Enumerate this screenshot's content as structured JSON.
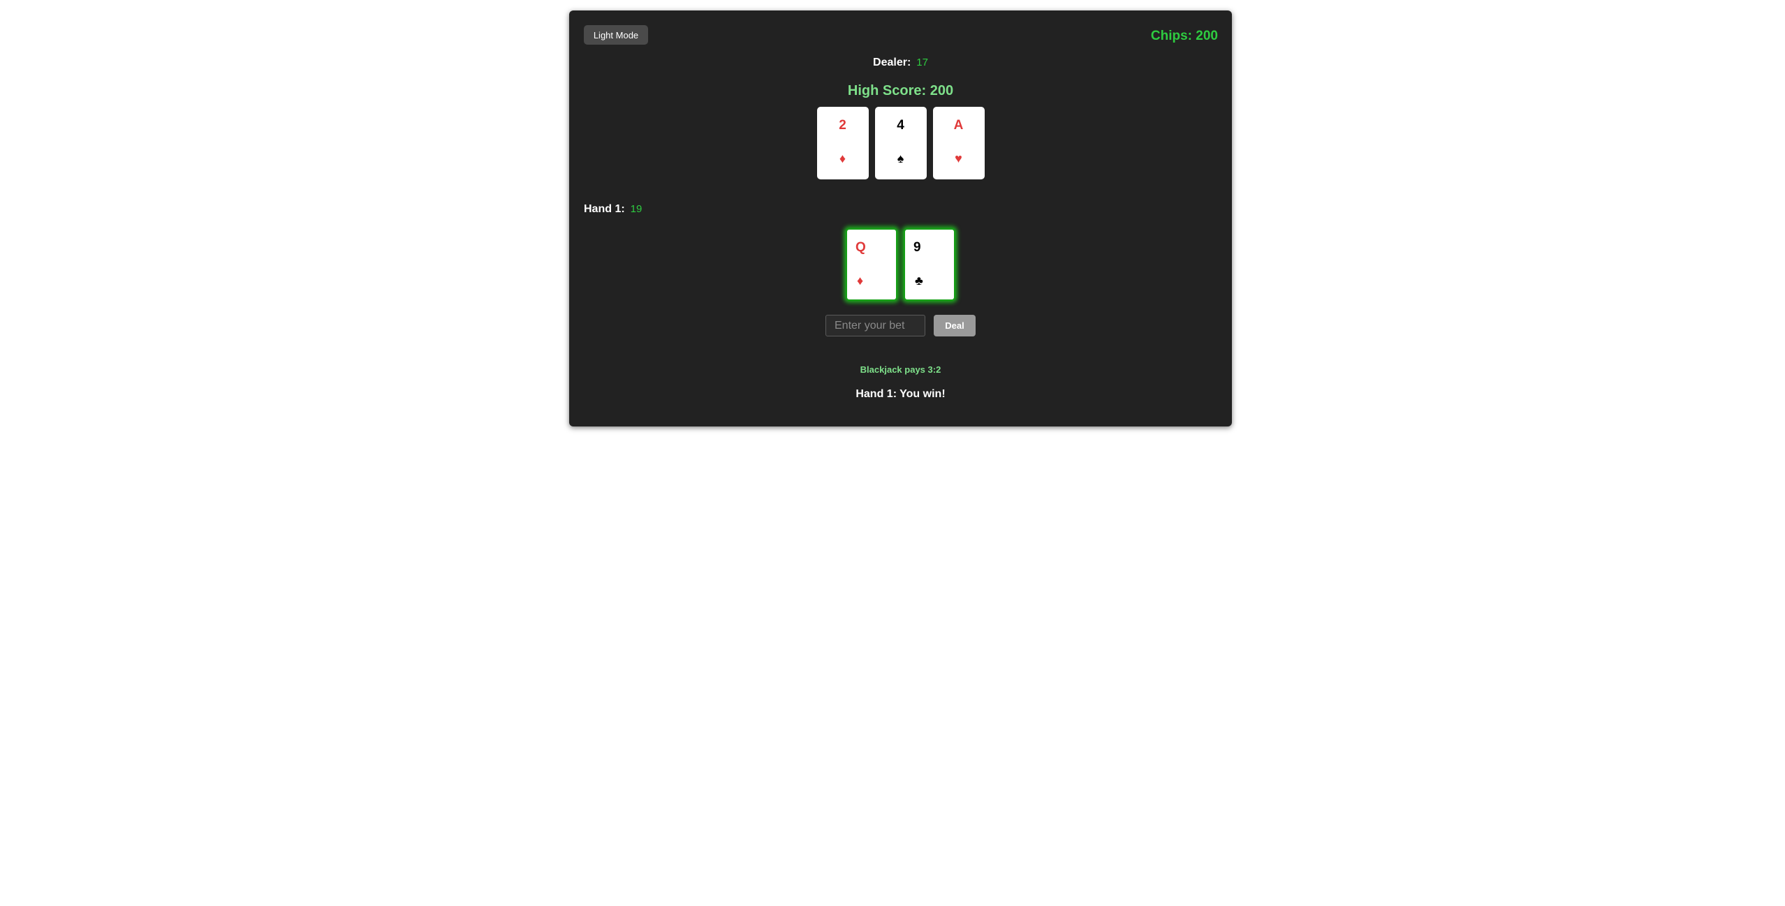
{
  "header": {
    "mode_toggle_label": "Light Mode",
    "chips_text": "Chips: 200"
  },
  "dealer": {
    "label": "Dealer:",
    "score": "17",
    "cards": [
      {
        "rank": "2",
        "suit": "♦",
        "color": "#e03a3a"
      },
      {
        "rank": "4",
        "suit": "♠",
        "color": "#000000"
      },
      {
        "rank": "A",
        "suit": "♥",
        "color": "#e03a3a"
      }
    ]
  },
  "high_score_text": "High Score: 200",
  "hand": {
    "label": "Hand 1:",
    "score": "19",
    "cards": [
      {
        "rank": "Q",
        "suit": "♦",
        "color": "#e03a3a"
      },
      {
        "rank": "9",
        "suit": "♣",
        "color": "#000000"
      }
    ]
  },
  "bet": {
    "placeholder": "Enter your bet",
    "value": "",
    "deal_label": "Deal"
  },
  "payout_text": "Blackjack pays 3:2",
  "result_text": "Hand 1: You win!",
  "colors": {
    "table_bg": "#222222",
    "accent_green": "#2ecc40",
    "light_green": "#7ee08a",
    "win_glow": "#1fa31f",
    "red_suit": "#e03a3a"
  }
}
